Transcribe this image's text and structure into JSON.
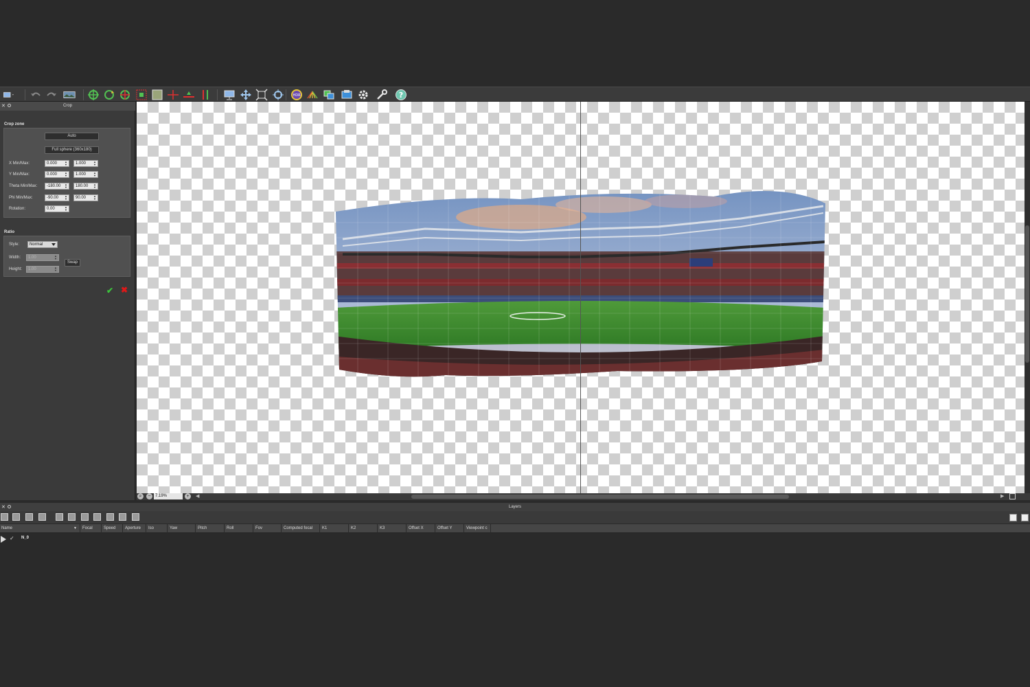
{
  "toolbar": {
    "icons": [
      "interface-menu-icon",
      "undo-icon",
      "redo-icon",
      "panorama-icon",
      "control-points-icon",
      "rotate-icon",
      "move-icon",
      "crop-icon",
      "mask-icon",
      "horizon-icon",
      "straighten-icon",
      "vertical-icon",
      "preview-icon",
      "pan-icon",
      "fit-icon",
      "center-icon",
      "hdr-icon",
      "color-icon",
      "blend-icon",
      "render-icon",
      "settings-icon",
      "tools-icon",
      "help-icon"
    ]
  },
  "crop_panel": {
    "title": "Crop",
    "crop_zone_label": "Crop zone",
    "auto_button": "Auto",
    "full_sphere_button": "Full sphere (360x180)",
    "fields": [
      {
        "label": "X Min/Max:",
        "min": "0.000",
        "max": "1.000"
      },
      {
        "label": "Y Min/Max:",
        "min": "0.000",
        "max": "1.000"
      },
      {
        "label": "Theta Min/Max:",
        "min": "-180.00",
        "max": "180.00"
      },
      {
        "label": "Phi Min/Max:",
        "min": "-90.00",
        "max": "90.00"
      }
    ],
    "rotation_label": "Rotation:",
    "rotation_value": "0.00",
    "ratio_label": "Ratio",
    "style_label": "Style:",
    "style_value": "Normal",
    "width_label": "Width:",
    "width_value": "1.00",
    "height_label": "Height:",
    "height_value": "1.00",
    "swap_button": "Swap"
  },
  "canvas": {
    "zoom": "7.19%"
  },
  "layers": {
    "title": "Layers",
    "columns": [
      "Name",
      "Focal",
      "Speed",
      "Aperture",
      "Iso",
      "Yaw",
      "Pitch",
      "Roll",
      "Fov",
      "Computed focal",
      "K1",
      "K2",
      "K3",
      "Offset X",
      "Offset Y",
      "Viewpoint c"
    ],
    "rows": [
      {
        "name": "N_0",
        "checked": true
      }
    ]
  },
  "colors": {
    "background": "#2a2a2a",
    "panel": "#3a3a3a",
    "accept": "#3cc43c",
    "cancel": "#e01818"
  }
}
